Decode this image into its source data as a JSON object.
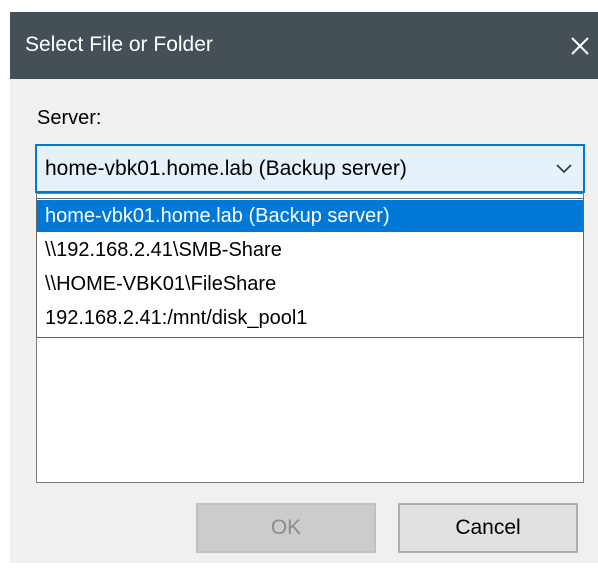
{
  "window": {
    "title": "Select File or Folder",
    "close_icon": "close-icon"
  },
  "server": {
    "label": "Server:",
    "selected_value": "home-vbk01.home.lab (Backup server)",
    "dropdown_icon": "chevron-down-icon",
    "options": [
      "home-vbk01.home.lab (Backup server)",
      "\\\\192.168.2.41\\SMB-Share",
      "\\\\HOME-VBK01\\FileShare",
      "192.168.2.41:/mnt/disk_pool1"
    ],
    "highlighted_index": 0
  },
  "buttons": {
    "ok_label": "OK",
    "cancel_label": "Cancel"
  },
  "colors": {
    "titlebar": "#454f56",
    "selection": "#0078d7",
    "dialog_background": "#f0f0f0"
  }
}
